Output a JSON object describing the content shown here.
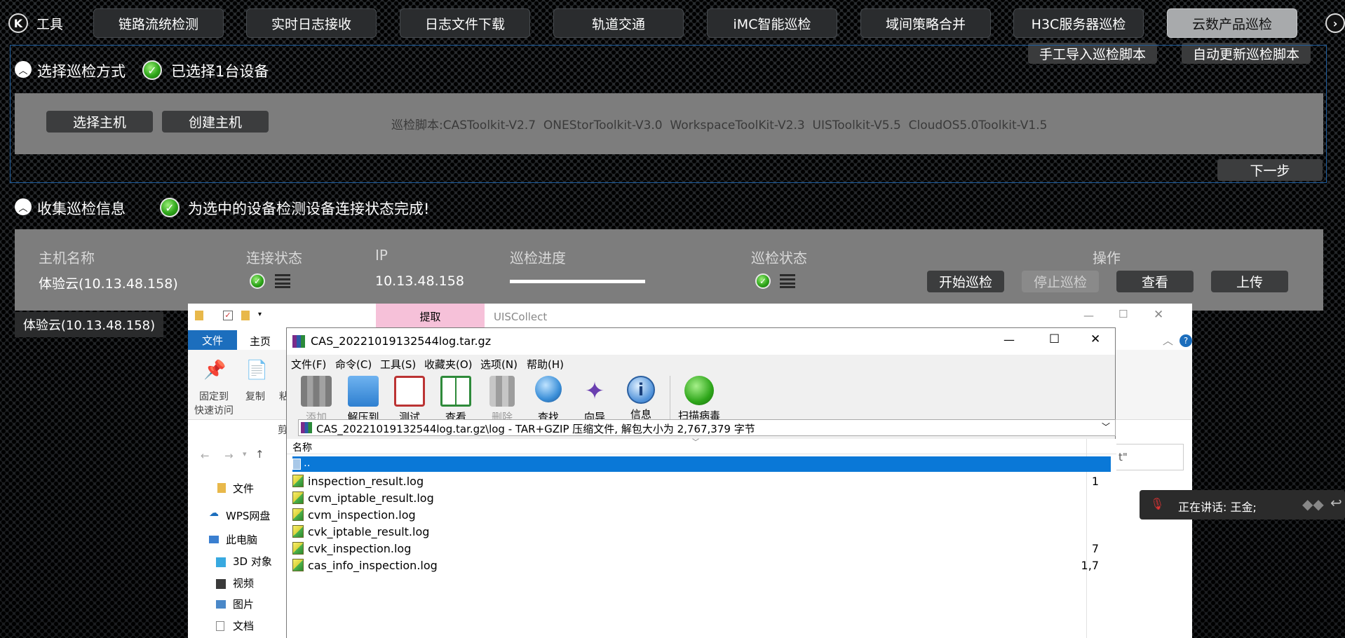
{
  "nav": {
    "tools_label": "工具",
    "tabs": [
      "链路流统检测",
      "实时日志接收",
      "日志文件下载",
      "轨道交通",
      "iMC智能巡检",
      "域间策略合并",
      "H3C服务器巡检",
      "云数产品巡检"
    ],
    "active_tab": "云数产品巡检"
  },
  "actions": {
    "manual_import": "手工导入巡检脚本",
    "auto_update": "自动更新巡检脚本"
  },
  "section1": {
    "title": "选择巡检方式",
    "status": "已选择1台设备",
    "select_host": "选择主机",
    "create_host": "创建主机",
    "scripts": "巡检脚本:CASToolkit-V2.7  ONEStorToolkit-V3.0  WorkspaceToolKit-V2.3  UISToolkit-V5.5  CloudOS5.0Toolkit-V1.5",
    "next": "下一步"
  },
  "section2": {
    "title": "收集巡检信息",
    "status": "为选中的设备检测设备连接状态完成!",
    "headers": {
      "host": "主机名称",
      "conn": "连接状态",
      "ip": "IP",
      "progress": "巡检进度",
      "inspect_status": "巡检状态",
      "ops": "操作"
    },
    "row": {
      "host": "体验云(10.13.48.158)",
      "ip": "10.13.48.158",
      "progress": 1.0
    },
    "buttons": {
      "start": "开始巡检",
      "stop": "停止巡检",
      "view": "查看",
      "upload": "上传"
    },
    "tooltip": "体验云(10.13.48.158)"
  },
  "explorer": {
    "extract_tab": "提取",
    "title": "UISCollect",
    "ribbon_tabs": [
      "文件",
      "主页"
    ],
    "pin_label_1": "固定到",
    "pin_label_2": "快速访问",
    "copy_label": "复制",
    "paste_partial": "粘",
    "clipboard_partial": "剪",
    "search_partial": "t\"",
    "sidebar": [
      "文件",
      "WPS网盘",
      "此电脑",
      "3D 对象",
      "视频",
      "图片",
      "文档"
    ]
  },
  "rar": {
    "title": "CAS_20221019132544log.tar.gz",
    "menu": [
      "文件(F)",
      "命令(C)",
      "工具(S)",
      "收藏夹(O)",
      "选项(N)",
      "帮助(H)"
    ],
    "tools": [
      {
        "label": "添加",
        "icon": "archive-add-icon",
        "disabled": true
      },
      {
        "label": "解压到",
        "icon": "folder-extract-icon",
        "disabled": false
      },
      {
        "label": "测试",
        "icon": "clipboard-test-icon",
        "disabled": false
      },
      {
        "label": "查看",
        "icon": "book-view-icon",
        "disabled": false
      },
      {
        "label": "删除",
        "icon": "trash-icon",
        "disabled": true
      },
      {
        "label": "查找",
        "icon": "magnifier-icon",
        "disabled": false
      },
      {
        "label": "向导",
        "icon": "wand-icon",
        "disabled": false
      },
      {
        "label": "信息",
        "icon": "info-icon",
        "disabled": false
      },
      {
        "label": "扫描病毒",
        "icon": "virus-scan-icon",
        "disabled": false
      }
    ],
    "path": "CAS_20221019132544log.tar.gz\\log - TAR+GZIP 压缩文件, 解包大小为 2,767,379 字节",
    "column_name": "名称",
    "parent": "..",
    "files": [
      {
        "name": "inspection_result.log",
        "size": "1"
      },
      {
        "name": "cvm_iptable_result.log",
        "size": ""
      },
      {
        "name": "cvm_inspection.log",
        "size": ""
      },
      {
        "name": "cvk_iptable_result.log",
        "size": ""
      },
      {
        "name": "cvk_inspection.log",
        "size": "7"
      },
      {
        "name": "cas_info_inspection.log",
        "size": "1,7"
      }
    ]
  },
  "voice": {
    "label": "正在讲话: 王金;"
  }
}
